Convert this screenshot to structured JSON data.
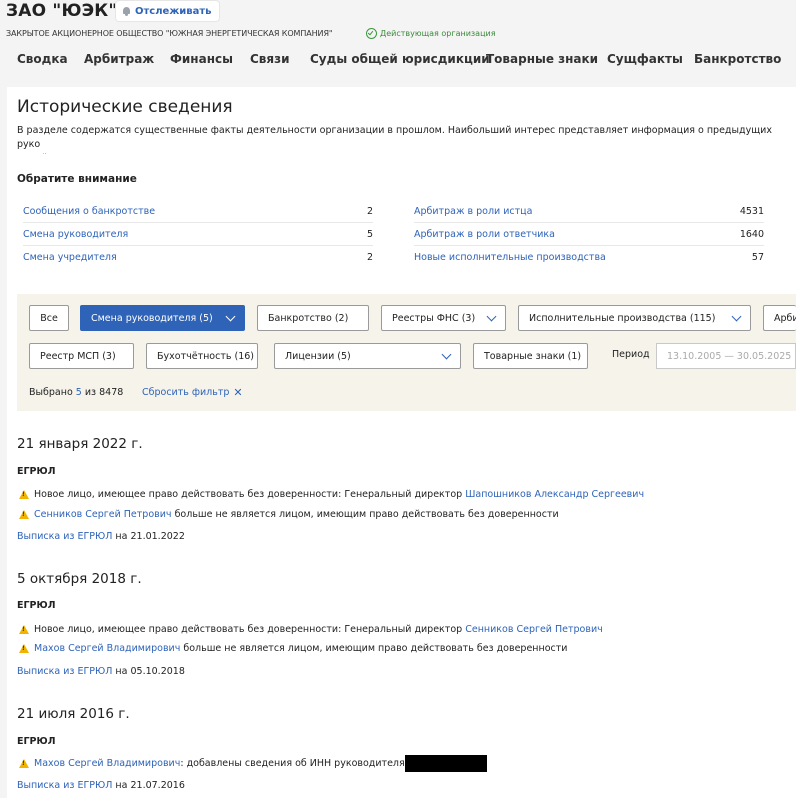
{
  "header": {
    "title": "ЗАО \"ЮЭК\"",
    "follow_label": "Отслеживать",
    "full_name": "ЗАКРЫТОЕ АКЦИОНЕРНОЕ ОБЩЕСТВО \"ЮЖНАЯ ЭНЕРГЕТИЧЕСКАЯ КОМПАНИЯ\"",
    "status": "Действующая организация",
    "status_color": "#3a8a3a"
  },
  "nav": [
    "Сводка",
    "Арбитраж",
    "Финансы",
    "Связи",
    "Суды общей юрисдикции",
    "Товарные знаки",
    "Сущфакты",
    "Банкротство"
  ],
  "section": {
    "title": "Исторические сведения",
    "intro": "В разделе содержатся существенные факты деятельности организации в прошлом. Наибольший интерес представляет информация о предыдущих руко\nдолей."
  },
  "attention": {
    "title": "Обратите внимание",
    "left": [
      {
        "label": "Сообщения о банкротстве",
        "count": "2"
      },
      {
        "label": "Смена руководителя",
        "count": "5"
      },
      {
        "label": "Смена учредителя",
        "count": "2"
      }
    ],
    "right": [
      {
        "label": "Арбитраж в роли истца",
        "count": "4531"
      },
      {
        "label": "Арбитраж в роли ответчика",
        "count": "1640"
      },
      {
        "label": "Новые исполнительные производства",
        "count": "57"
      }
    ]
  },
  "filters": {
    "row1": [
      "Все",
      "Смена руководителя (5)",
      "Банкротство (2)",
      "Реестры ФНС (3)",
      "Исполнительные производства (115)",
      "Арби"
    ],
    "row2": [
      "Реестр МСП (3)",
      "Бухотчётность (16)",
      "Лицензии (5)",
      "Товарные знаки (1)"
    ],
    "period_label": "Период",
    "period_value": "13.10.2005 — 30.05.2025",
    "selected_prefix": "Выбрано",
    "selected_count": "5",
    "selected_of": "из 8478",
    "reset_label": "Сбросить фильтр",
    "accent": "#2e63b8"
  },
  "events": [
    {
      "date": "21 января 2022 г.",
      "source": "ЕГРЮЛ",
      "line1_text": "Новое лицо, имеющее право действовать без доверенности: Генеральный директор",
      "line1_link": "Шапошников Александр Сергеевич",
      "line2_link": "Сенников Сергей Петрович",
      "line2_text": "больше не является лицом, имеющим право действовать без доверенности",
      "extract_link": "Выписка из ЕГРЮЛ",
      "extract_date": "на 21.01.2022"
    },
    {
      "date": "5 октября 2018 г.",
      "source": "ЕГРЮЛ",
      "line1_text": "Новое лицо, имеющее право действовать без доверенности: Генеральный директор",
      "line1_link": "Сенников Сергей Петрович",
      "line2_link": "Махов Сергей Владимирович",
      "line2_text": "больше не является лицом, имеющим право действовать без доверенности",
      "extract_link": "Выписка из ЕГРЮЛ",
      "extract_date": "на 05.10.2018"
    },
    {
      "date": "21 июля 2016 г.",
      "source": "ЕГРЮЛ",
      "line1_link": "Махов Сергей Владимирович",
      "line1_text": ": добавлены сведения об ИНН руководителя",
      "extract_link": "Выписка из ЕГРЮЛ",
      "extract_date": "на 21.07.2016"
    }
  ]
}
